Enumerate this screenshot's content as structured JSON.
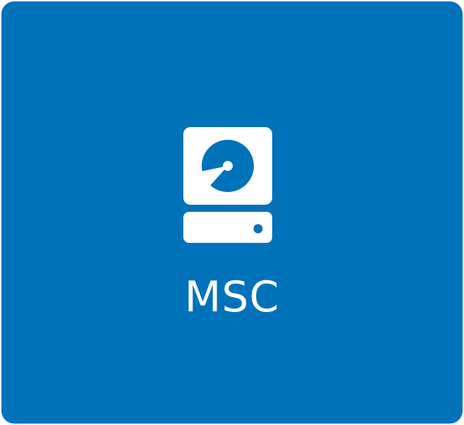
{
  "tile": {
    "label": "MSC",
    "icon": "hard-drive-icon",
    "background_color": "#0072ba",
    "foreground_color": "#ffffff"
  }
}
